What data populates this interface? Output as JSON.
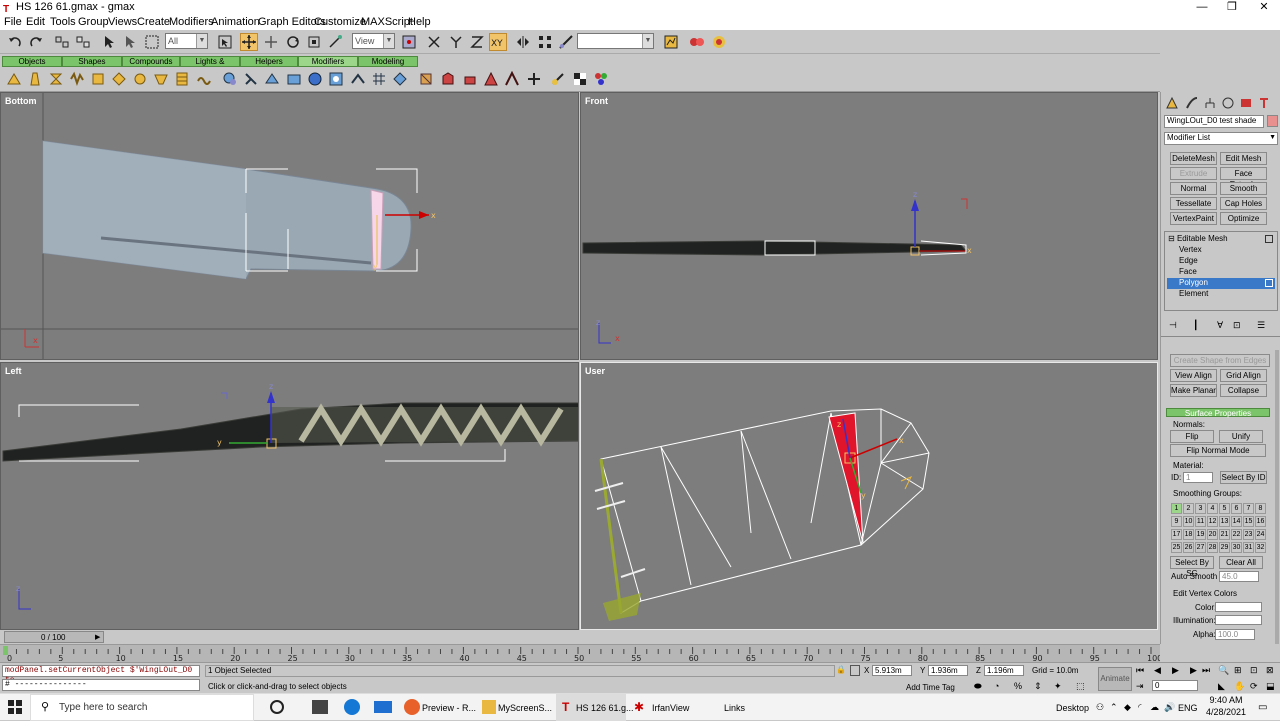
{
  "window": {
    "title": "HS 126 61.gmax - gmax",
    "minimize": "—",
    "restore": "❐",
    "close": "✕"
  },
  "menu": [
    "File",
    "Edit",
    "Tools",
    "Group",
    "Views",
    "Create",
    "Modifiers",
    "Animation",
    "Graph Editors",
    "Customize",
    "MAXScript",
    "Help"
  ],
  "toolbar": {
    "selection_filter": "All",
    "ref_coord": "View",
    "named_selection": ""
  },
  "tabs": [
    "Objects",
    "Shapes",
    "Compounds",
    "Lights & Cameras",
    "Helpers",
    "Modifiers",
    "Modeling"
  ],
  "viewports": {
    "top_left": "Bottom",
    "top_right": "Front",
    "bottom_left": "Left",
    "bottom_right": "User"
  },
  "axis": {
    "x": "x",
    "y": "y",
    "z": "z"
  },
  "panel": {
    "object_name": "WingLOut_D0 test shade",
    "modifier_list": "Modifier List",
    "modifier_buttons": [
      "DeleteMesh",
      "Edit Mesh",
      "Extrude",
      "Face Extrude",
      "Normal",
      "Smooth",
      "Tessellate",
      "Cap Holes",
      "VertexPaint",
      "Optimize"
    ],
    "stack": [
      "Editable Mesh",
      "Vertex",
      "Edge",
      "Face",
      "Polygon",
      "Element"
    ],
    "create_shape": "Create Shape from Edges",
    "view_align": "View Align",
    "grid_align": "Grid Align",
    "make_planar": "Make Planar",
    "collapse": "Collapse",
    "surface_properties": "Surface Properties",
    "normals_label": "Normals:",
    "flip": "Flip",
    "unify": "Unify",
    "flip_normal_mode": "Flip Normal Mode",
    "material_label": "Material:",
    "id_label": "ID:",
    "id_value": "1",
    "select_by_id": "Select By ID",
    "smoothing_groups": "Smoothing Groups:",
    "sg_numbers": [
      "1",
      "2",
      "3",
      "4",
      "5",
      "6",
      "7",
      "8",
      "9",
      "10",
      "11",
      "12",
      "13",
      "14",
      "15",
      "16",
      "17",
      "18",
      "19",
      "20",
      "21",
      "22",
      "23",
      "24",
      "25",
      "26",
      "27",
      "28",
      "29",
      "30",
      "31",
      "32"
    ],
    "select_by_sg": "Select By SG",
    "clear_all": "Clear All",
    "auto_smooth": "Auto Smooth",
    "auto_smooth_value": "45.0",
    "edit_vertex_colors": "Edit Vertex Colors",
    "color_label": "Color:",
    "illumination_label": "Illumination:",
    "alpha_label": "Alpha:",
    "alpha_value": "100.0"
  },
  "timeline": {
    "frame": "0 / 100",
    "ticks": [
      "0",
      "5",
      "10",
      "15",
      "20",
      "25",
      "30",
      "35",
      "40",
      "45",
      "50",
      "55",
      "60",
      "65",
      "70",
      "75",
      "80",
      "85",
      "90",
      "95",
      "100"
    ]
  },
  "status": {
    "script": "modPanel.setCurrentObject $'WingLOut_D0 te",
    "script2": "# ---------------",
    "selected": "1 Object Selected",
    "prompt": "Click or click-and-drag to select objects",
    "x_label": "X",
    "x_value": "5.913m",
    "y_label": "Y",
    "y_value": "1.936m",
    "z_label": "Z",
    "z_value": "1.196m",
    "grid": "Grid = 10.0m",
    "add_time_tag": "Add Time Tag",
    "animate": "Animate",
    "frame_field": "0"
  },
  "taskbar": {
    "search": "Type here to search",
    "apps": [
      "Preview - R...",
      "MyScreenS...",
      "HS 126 61.g...",
      "IrfanView"
    ],
    "links": "Links",
    "desktop": "Desktop",
    "lang": "ENG",
    "time": "9:40 AM",
    "date": "4/28/2021"
  }
}
